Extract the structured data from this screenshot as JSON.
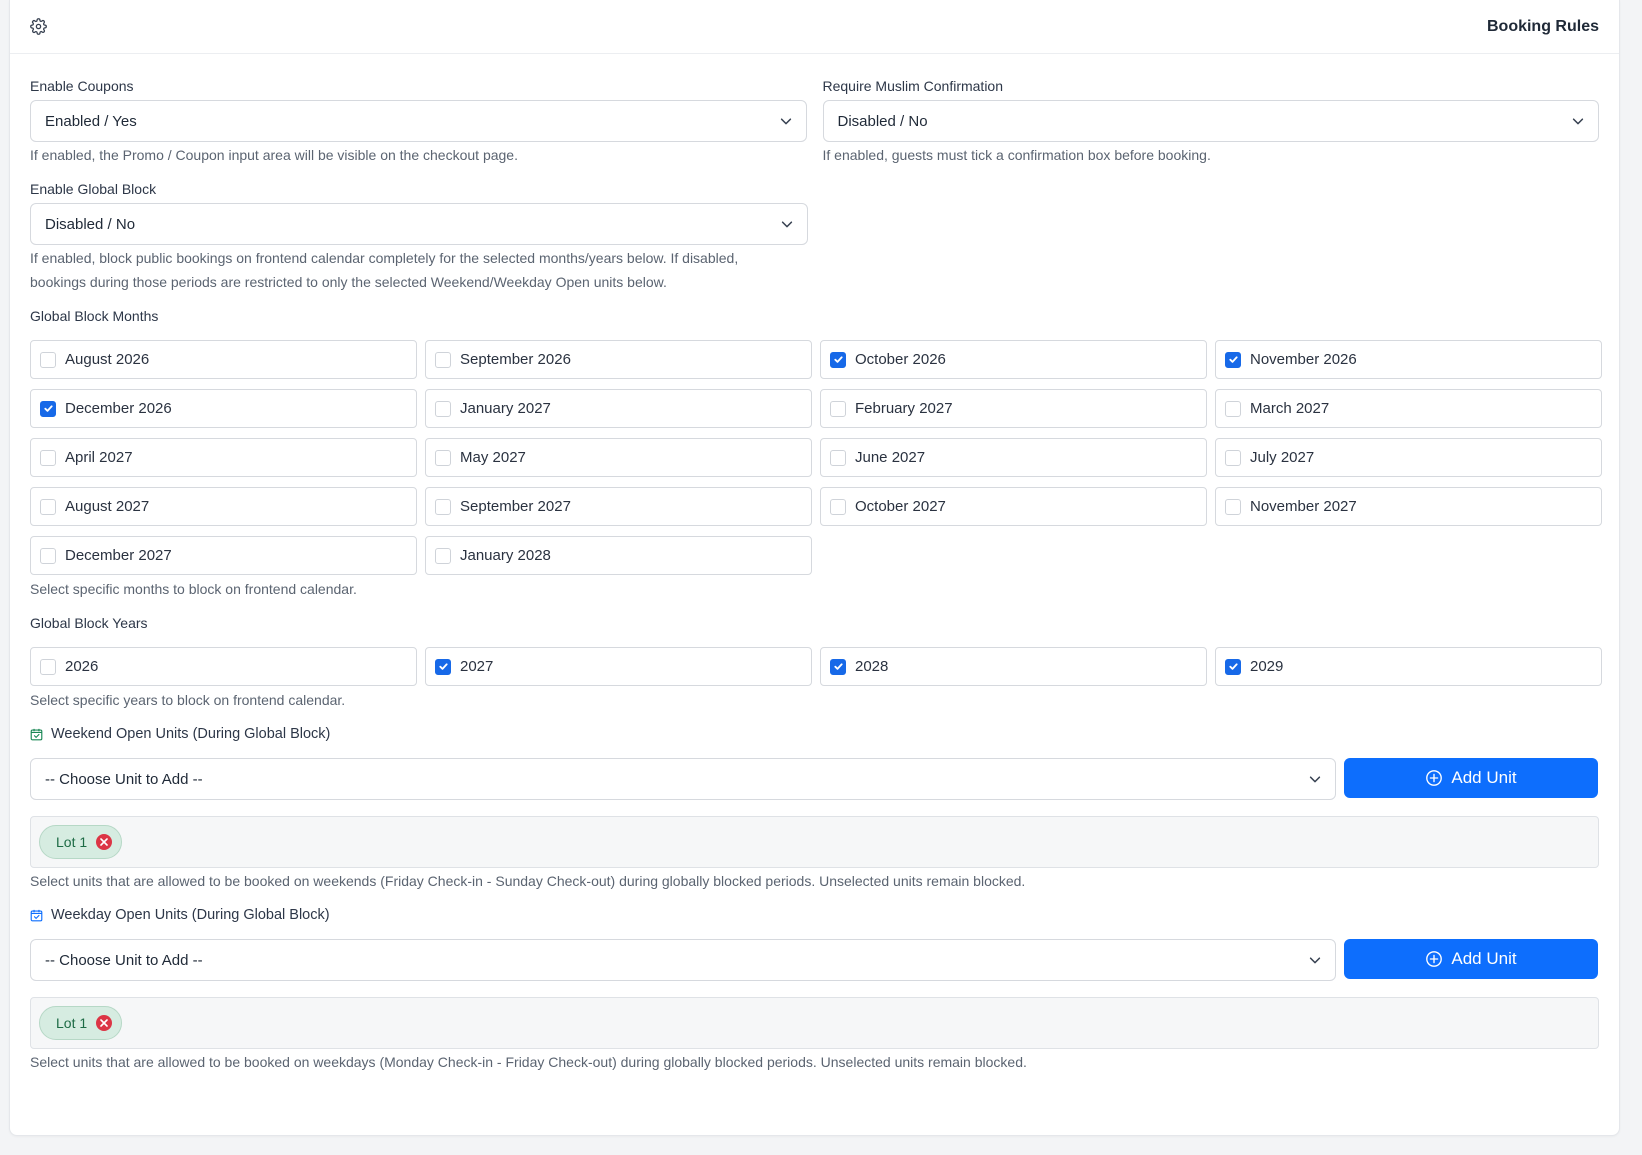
{
  "header": {
    "title": "Booking Rules",
    "settings_icon": "gear-icon"
  },
  "coupons": {
    "label": "Enable Coupons",
    "value": "Enabled / Yes",
    "help": "If enabled, the Promo / Coupon input area will be visible on the checkout page."
  },
  "muslim": {
    "label": "Require Muslim Confirmation",
    "value": "Disabled / No",
    "help": "If enabled, guests must tick a confirmation box before booking."
  },
  "global_block": {
    "label": "Enable Global Block",
    "value": "Disabled / No",
    "help_line1": "If enabled, block public bookings on frontend calendar completely for the selected months/years below. If disabled,",
    "help_line2": "bookings during those periods are restricted to only the selected Weekend/Weekday Open units below."
  },
  "months": {
    "label": "Global Block Months",
    "help": "Select specific months to block on frontend calendar.",
    "items": [
      {
        "label": "August 2026",
        "checked": false
      },
      {
        "label": "September 2026",
        "checked": false
      },
      {
        "label": "October 2026",
        "checked": true
      },
      {
        "label": "November 2026",
        "checked": true
      },
      {
        "label": "December 2026",
        "checked": true
      },
      {
        "label": "January 2027",
        "checked": false
      },
      {
        "label": "February 2027",
        "checked": false
      },
      {
        "label": "March 2027",
        "checked": false
      },
      {
        "label": "April 2027",
        "checked": false
      },
      {
        "label": "May 2027",
        "checked": false
      },
      {
        "label": "June 2027",
        "checked": false
      },
      {
        "label": "July 2027",
        "checked": false
      },
      {
        "label": "August 2027",
        "checked": false
      },
      {
        "label": "September 2027",
        "checked": false
      },
      {
        "label": "October 2027",
        "checked": false
      },
      {
        "label": "November 2027",
        "checked": false
      },
      {
        "label": "December 2027",
        "checked": false
      },
      {
        "label": "January 2028",
        "checked": false
      }
    ]
  },
  "years": {
    "label": "Global Block Years",
    "help": "Select specific years to block on frontend calendar.",
    "items": [
      {
        "label": "2026",
        "checked": false
      },
      {
        "label": "2027",
        "checked": true
      },
      {
        "label": "2028",
        "checked": true
      },
      {
        "label": "2029",
        "checked": true
      }
    ]
  },
  "weekend": {
    "title": "Weekend Open Units (During Global Block)",
    "icon": "calendar-check-icon",
    "select_value": "-- Choose Unit to Add --",
    "button": "Add Unit",
    "tags": [
      "Lot 1"
    ],
    "help": "Select units that are allowed to be booked on weekends (Friday Check-in - Sunday Check-out) during globally blocked periods. Unselected units remain blocked.",
    "accent": "#198754"
  },
  "weekday": {
    "title": "Weekday Open Units (During Global Block)",
    "icon": "calendar-check-icon",
    "select_value": "-- Choose Unit to Add --",
    "button": "Add Unit",
    "tags": [
      "Lot 1"
    ],
    "help": "Select units that are allowed to be booked on weekdays (Monday Check-in - Friday Check-out) during globally blocked periods. Unselected units remain blocked.",
    "accent": "#0d6efd"
  },
  "colors": {
    "primary": "#0d6efd",
    "checked": "#1769e8",
    "danger": "#dc3545",
    "tag_bg": "#d6ece1"
  }
}
